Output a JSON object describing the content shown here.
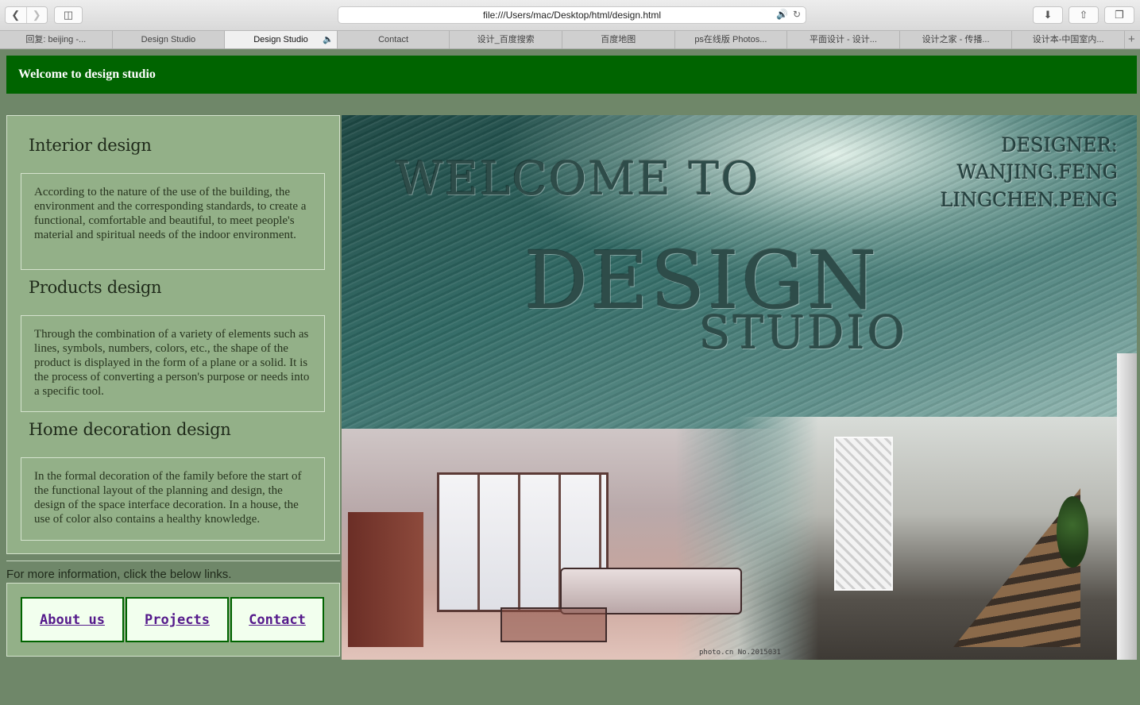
{
  "browser": {
    "url": "file:///Users/mac/Desktop/html/design.html",
    "tabs": [
      {
        "label": "回复:  beijing -..."
      },
      {
        "label": "Design Studio"
      },
      {
        "label": "Design Studio",
        "active": true
      },
      {
        "label": "Contact"
      },
      {
        "label": "设计_百度搜索"
      },
      {
        "label": "百度地图"
      },
      {
        "label": "ps在线版 Photos..."
      },
      {
        "label": "平面设计 - 设计..."
      },
      {
        "label": "设计之家 - 传播..."
      },
      {
        "label": "设计本-中国室内..."
      }
    ],
    "icons": {
      "back": "chevron-left-icon",
      "forward": "chevron-right-icon",
      "sidebar": "sidebar-icon",
      "audio": "speaker-icon",
      "reload": "reload-icon",
      "download": "download-icon",
      "share": "share-icon",
      "tabs": "tabs-icon",
      "new_tab": "plus-icon"
    }
  },
  "page": {
    "header_title": "Welcome to design studio",
    "sections": [
      {
        "title": "Interior design",
        "description": "According to the nature of the use of the building, the environment and the corresponding standards, to create a functional, comfortable and beautiful, to meet people's material and spiritual needs of the indoor environment."
      },
      {
        "title": "Products design",
        "description": "Through the combination of a variety of elements such as lines, symbols, numbers, colors, etc., the shape of the product is displayed in the form of a plane or a solid. It is the process of converting a person's purpose or needs into a specific tool."
      },
      {
        "title": "Home decoration design",
        "description": "In the formal decoration of the family before the start of the functional layout of the planning and design, the design of the space interface decoration. In a house, the use of color also contains a healthy knowledge."
      }
    ],
    "info_text": "For more information, click the below links.",
    "links": [
      {
        "label": "About us"
      },
      {
        "label": "Projects"
      },
      {
        "label": "Contact"
      }
    ],
    "hero": {
      "line1": "WELCOME TO",
      "line2": "DESIGN",
      "line3": "STUDIO",
      "designer_label": "DESIGNER:",
      "designer_1": "WANJING.FENG",
      "designer_2": "LINGCHEN.PENG",
      "watermark": "photo.cn   No.2015031"
    },
    "colors": {
      "header_bg": "#006400",
      "page_bg": "#6f8769",
      "panel_bg": "#93b088",
      "link_color": "#551a8b"
    }
  }
}
